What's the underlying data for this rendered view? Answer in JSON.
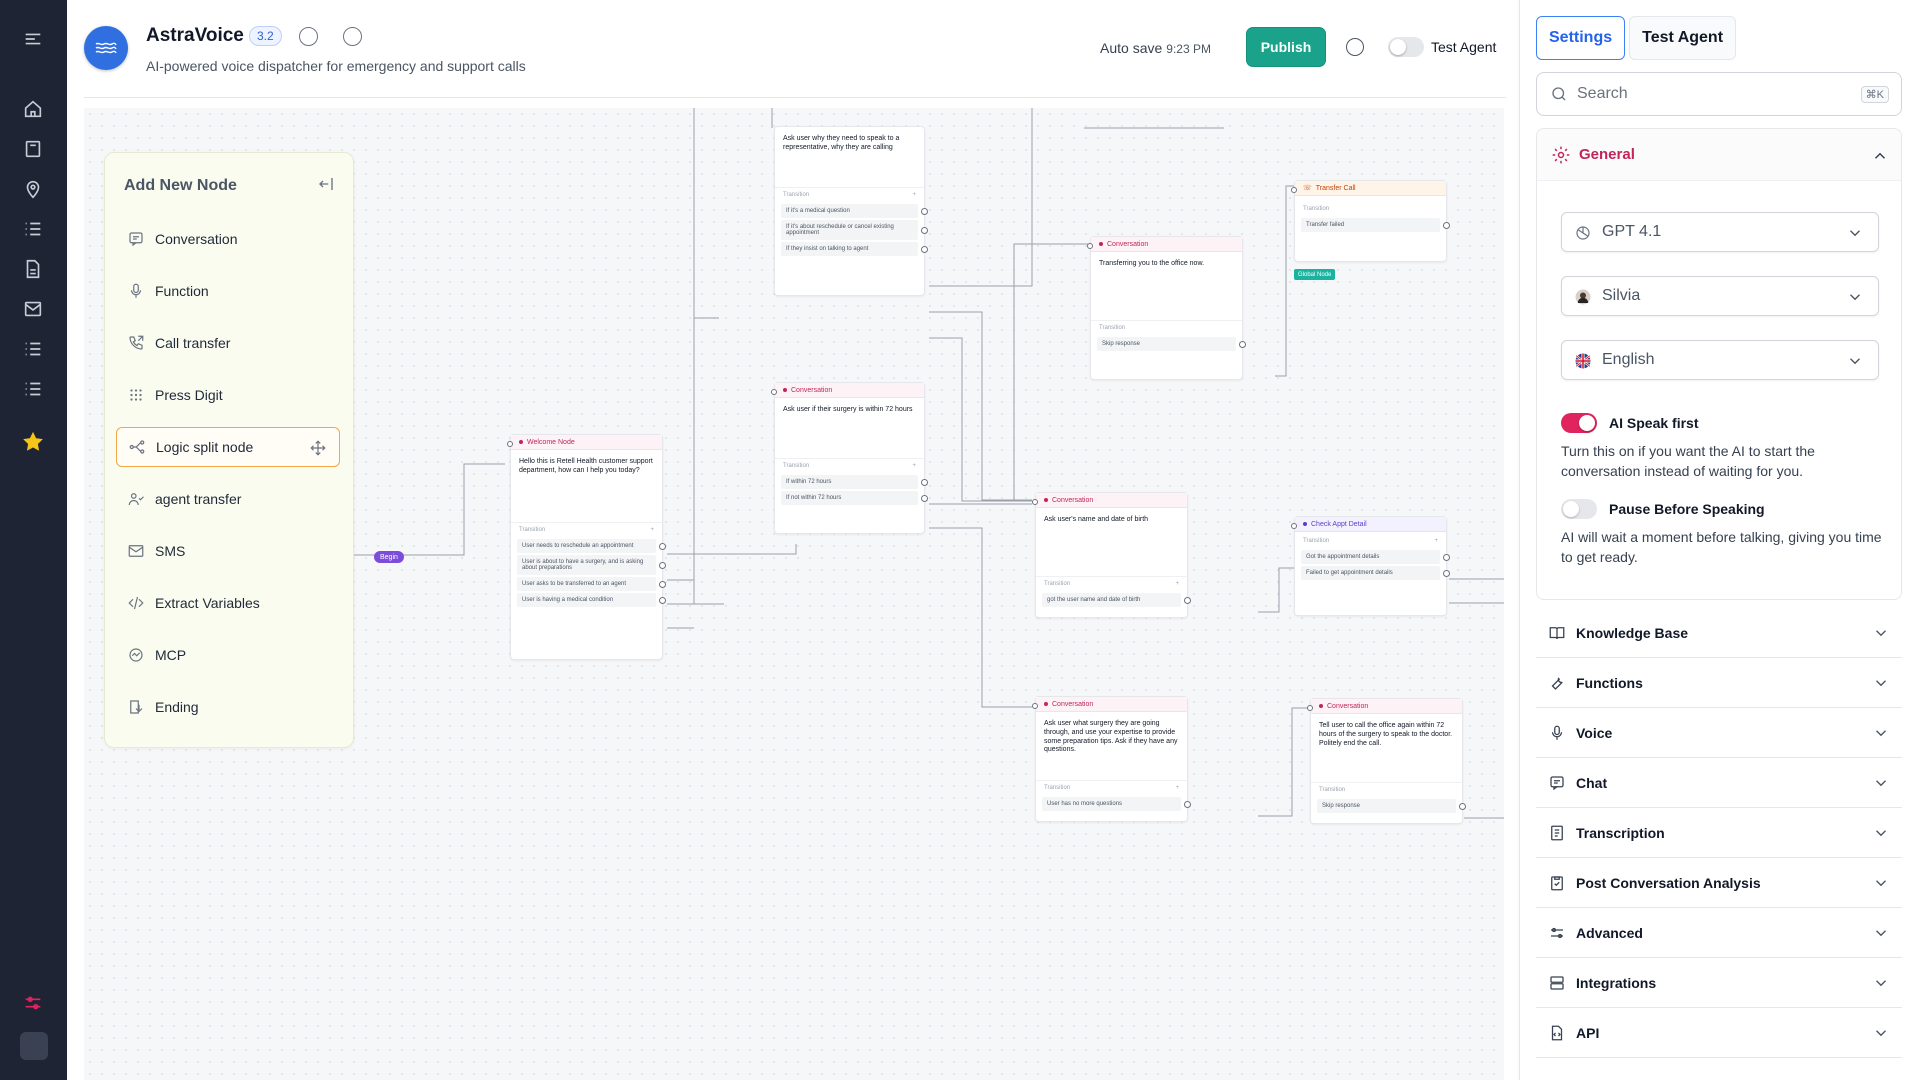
{
  "app": {
    "name": "AstraVoice",
    "version": "3.2",
    "subtitle": "AI-powered voice dispatcher for emergency and support calls",
    "autosave_label": "Auto save",
    "autosave_time": "9:23 PM",
    "publish_label": "Publish",
    "test_agent_label": "Test Agent"
  },
  "add_node": {
    "title": "Add New Node",
    "items": [
      {
        "label": "Conversation",
        "icon": "chat-icon"
      },
      {
        "label": "Function",
        "icon": "mic-icon"
      },
      {
        "label": "Call transfer",
        "icon": "phone-transfer-icon"
      },
      {
        "label": "Press Digit",
        "icon": "keypad-icon"
      },
      {
        "label": "Logic split node",
        "icon": "split-icon"
      },
      {
        "label": "agent transfer",
        "icon": "users-icon"
      },
      {
        "label": "SMS",
        "icon": "mail-icon"
      },
      {
        "label": "Extract Variables",
        "icon": "code-icon"
      },
      {
        "label": "MCP",
        "icon": "mcp-icon"
      },
      {
        "label": "Ending",
        "icon": "ending-icon"
      }
    ]
  },
  "flow": {
    "begin_label": "Begin",
    "global_tag": "Global Node",
    "transition_label": "Transition",
    "nodes": {
      "top_question": {
        "body": "Ask user why they need to speak to a representative, why they are calling",
        "conds": [
          "If it's a medical question",
          "If it's about reschedule or cancel existing appointment",
          "If they insist on talking to agent"
        ]
      },
      "transfer_call": {
        "title": "Transfer Call",
        "conds": [
          "Transfer failed"
        ]
      },
      "transfer_conv": {
        "title": "Conversation",
        "body": "Transferring you to the office now.",
        "conds": [
          "Skip response"
        ]
      },
      "surgery_72": {
        "title": "Conversation",
        "body": "Ask user if their surgery is within 72 hours",
        "conds": [
          "If within 72 hours",
          "If not within 72 hours"
        ]
      },
      "welcome": {
        "title": "Welcome Node",
        "body": "Hello this is Retell Health customer support department, how can I help you today?",
        "conds": [
          "User needs to reschedule an appointment",
          "User is about to have a surgery, and is asking about preparations",
          "User asks to be transferred to an agent",
          "User is having a medical condition"
        ]
      },
      "name_dob": {
        "title": "Conversation",
        "body": "Ask user's name and date of birth",
        "conds": [
          "got the user name and date of birth"
        ]
      },
      "check_appt": {
        "title": "Check Appt Detail",
        "conds": [
          "Got the appointment details",
          "Failed to get appointment details"
        ]
      },
      "surgery_tips": {
        "title": "Conversation",
        "body": "Ask user what surgery they are going through, and use your expertise to provide some preparation tips. Ask if they have any questions.",
        "conds": [
          "User has no more questions"
        ]
      },
      "call_again": {
        "title": "Conversation",
        "body": "Tell user to call the office again within 72 hours of the surgery to speak to the doctor. Politely end the call.",
        "conds": [
          "Skip response"
        ]
      }
    }
  },
  "settings": {
    "tabs": [
      "Settings",
      "Test Agent"
    ],
    "search_placeholder": "Search",
    "search_shortcut": "⌘K",
    "general_title": "General",
    "model": "GPT 4.1",
    "voice": "Silvia",
    "language": "English",
    "ai_speak_first": {
      "label": "AI Speak first",
      "on": true,
      "desc": "Turn this on if you want the AI to start the conversation instead of waiting for you."
    },
    "pause_before": {
      "label": "Pause Before Speaking",
      "on": false,
      "desc": "AI will wait a moment before talking, giving you time to get ready."
    },
    "sections": [
      "Knowledge Base",
      "Functions",
      "Voice",
      "Chat",
      "Transcription",
      "Post Conversation Analysis",
      "Advanced",
      "Integrations",
      "API"
    ]
  },
  "colors": {
    "accent": "#e0245e",
    "publish": "#1aa38a",
    "tab_active": "#2563eb",
    "rail": "#1e2433"
  }
}
